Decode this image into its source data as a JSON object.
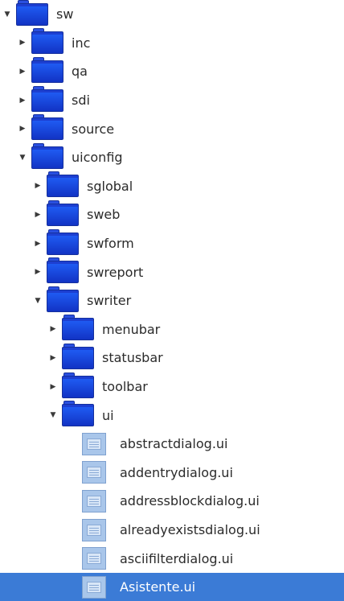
{
  "tree": [
    {
      "label": "sw",
      "kind": "folder",
      "depth": 0,
      "expander": "expanded"
    },
    {
      "label": "inc",
      "kind": "folder",
      "depth": 1,
      "expander": "collapsed"
    },
    {
      "label": "qa",
      "kind": "folder",
      "depth": 1,
      "expander": "collapsed"
    },
    {
      "label": "sdi",
      "kind": "folder",
      "depth": 1,
      "expander": "collapsed"
    },
    {
      "label": "source",
      "kind": "folder",
      "depth": 1,
      "expander": "collapsed"
    },
    {
      "label": "uiconfig",
      "kind": "folder",
      "depth": 1,
      "expander": "expanded"
    },
    {
      "label": "sglobal",
      "kind": "folder",
      "depth": 2,
      "expander": "collapsed"
    },
    {
      "label": "sweb",
      "kind": "folder",
      "depth": 2,
      "expander": "collapsed"
    },
    {
      "label": "swform",
      "kind": "folder",
      "depth": 2,
      "expander": "collapsed"
    },
    {
      "label": "swreport",
      "kind": "folder",
      "depth": 2,
      "expander": "collapsed"
    },
    {
      "label": "swriter",
      "kind": "folder",
      "depth": 2,
      "expander": "expanded"
    },
    {
      "label": "menubar",
      "kind": "folder",
      "depth": 3,
      "expander": "collapsed"
    },
    {
      "label": "statusbar",
      "kind": "folder",
      "depth": 3,
      "expander": "collapsed"
    },
    {
      "label": "toolbar",
      "kind": "folder",
      "depth": 3,
      "expander": "collapsed"
    },
    {
      "label": "ui",
      "kind": "folder",
      "depth": 3,
      "expander": "expanded"
    },
    {
      "label": "abstractdialog.ui",
      "kind": "file",
      "depth": 4,
      "expander": "none"
    },
    {
      "label": "addentrydialog.ui",
      "kind": "file",
      "depth": 4,
      "expander": "none"
    },
    {
      "label": "addressblockdialog.ui",
      "kind": "file",
      "depth": 4,
      "expander": "none"
    },
    {
      "label": "alreadyexistsdialog.ui",
      "kind": "file",
      "depth": 4,
      "expander": "none"
    },
    {
      "label": "asciifilterdialog.ui",
      "kind": "file",
      "depth": 4,
      "expander": "none"
    },
    {
      "label": "Asistente.ui",
      "kind": "file",
      "depth": 4,
      "expander": "none",
      "selected": true
    }
  ],
  "colors": {
    "selection": "#3b7bd6",
    "folder": "#1d3fd1",
    "file_icon": "#a9c6ea",
    "text": "#2b2b2b"
  },
  "icons": {
    "expanded": "triangle-down-icon",
    "collapsed": "triangle-right-icon",
    "folder": "folder-icon",
    "file": "ui-file-icon"
  }
}
